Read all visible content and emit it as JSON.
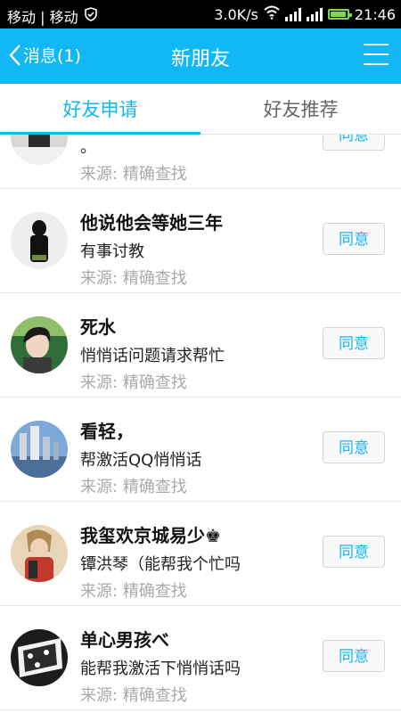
{
  "status_bar": {
    "carrier": "移动 | 移动",
    "network_speed": "3.0K/s",
    "time": "21:46",
    "icons": [
      "shield-icon",
      "wifi-icon",
      "signal-icon",
      "signal-icon",
      "battery-icon"
    ]
  },
  "header": {
    "back_label": "消息(1)",
    "title": "新朋友",
    "menu_icon": "menu-icon",
    "color": "#12b7f5"
  },
  "tabs": [
    {
      "label": "好友申请",
      "active": true
    },
    {
      "label": "好友推荐",
      "active": false
    }
  ],
  "requests": [
    {
      "name": "",
      "message": "。",
      "source": "来源: 精确查找",
      "button": "同意"
    },
    {
      "name": "他说他会等她三年",
      "message": "有事讨教",
      "source": "来源: 精确查找",
      "button": "同意"
    },
    {
      "name": "死水",
      "message": "悄悄话问题请求帮忙",
      "source": "来源: 精确查找",
      "button": "同意"
    },
    {
      "name": "看轻，",
      "message": "帮激活QQ悄悄话",
      "source": "来源: 精确查找",
      "button": "同意"
    },
    {
      "name": "我玺欢京城易少♚",
      "message": "镡洪琴（能帮我个忙吗",
      "source": "来源: 精确查找",
      "button": "同意"
    },
    {
      "name": "单心男孩べ",
      "message": "能帮我激活下悄悄话吗",
      "source": "来源: 精确查找",
      "button": "同意"
    }
  ]
}
